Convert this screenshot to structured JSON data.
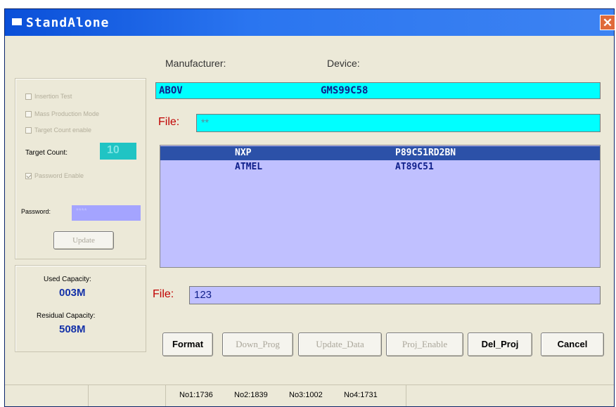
{
  "window": {
    "title": "StandAlone",
    "close_glyph": "✕"
  },
  "options": {
    "insertion_test": "Insertion Test",
    "mass_production": "Mass Production Mode",
    "target_count_enable": "Target Count enable",
    "target_count_label": "Target Count:",
    "target_count_value": "10",
    "password_enable": "Password Enable",
    "password_label": "Password:",
    "password_value": "****",
    "update_button": "Update"
  },
  "capacity": {
    "used_label": "Used Capacity:",
    "used_value": "003M",
    "residual_label": "Residual Capacity:",
    "residual_value": "508M"
  },
  "header": {
    "manufacturer_label": "Manufacturer:",
    "device_label": "Device:",
    "manufacturer_value": "ABOV",
    "device_value": "GMS99C58"
  },
  "file_top": {
    "label": "File:",
    "value": "**"
  },
  "project_list": [
    {
      "manufacturer": "NXP",
      "device": "P89C51RD2BN",
      "selected": true
    },
    {
      "manufacturer": "ATMEL",
      "device": "AT89C51",
      "selected": false
    }
  ],
  "file_bottom": {
    "label": "File:",
    "value": "123"
  },
  "buttons": {
    "format": "Format",
    "down_prog": "Down_Prog",
    "update_data": "Update_Data",
    "proj_enable": "Proj_Enable",
    "del_proj": "Del_Proj",
    "cancel": "Cancel"
  },
  "status_bar": {
    "no1": "No1:1736",
    "no2": "No2:1839",
    "no3": "No3:1002",
    "no4": "No4:1731"
  },
  "colors": {
    "accent_cyan": "#00ffff",
    "list_bg": "#c0c0ff",
    "selection": "#2c51a8",
    "file_label": "#c00000"
  }
}
